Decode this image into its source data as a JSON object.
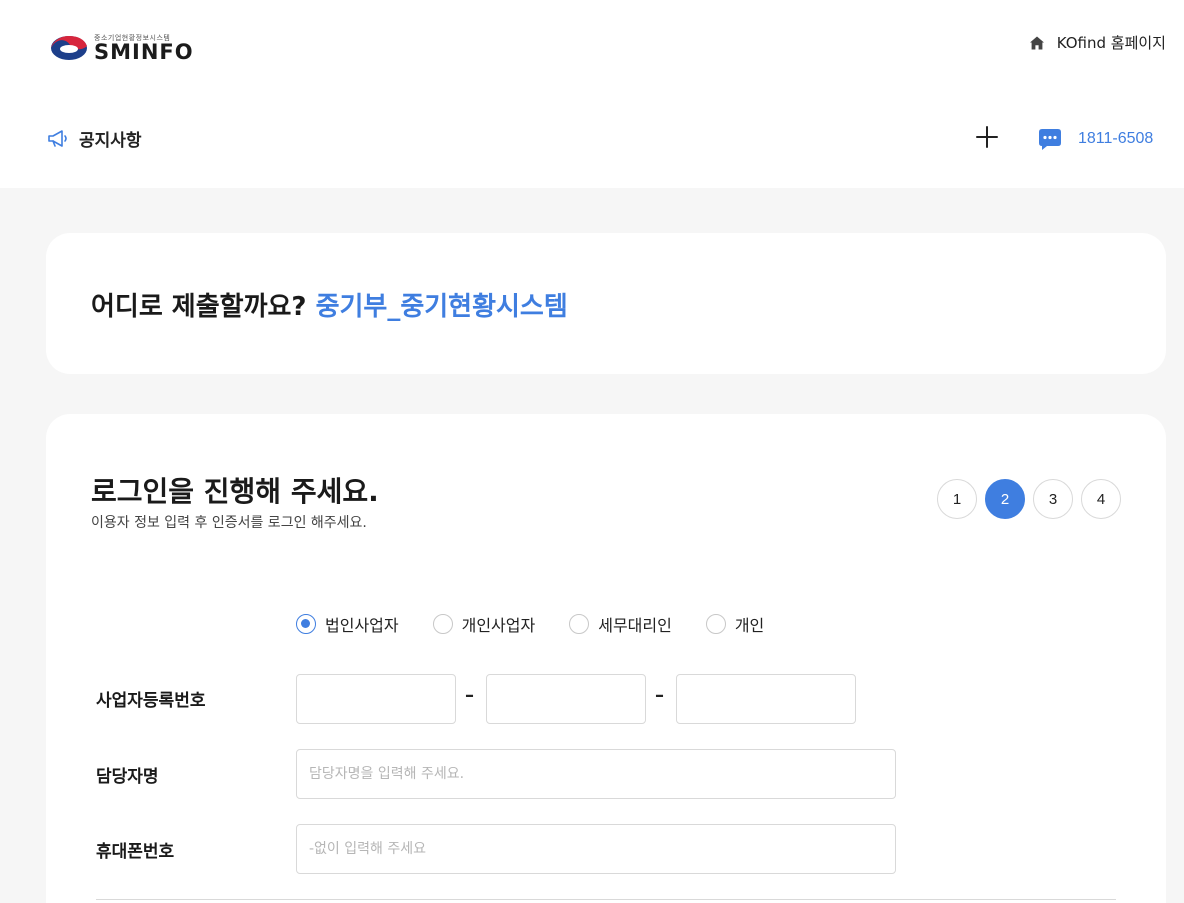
{
  "header": {
    "logo": {
      "subtitle": "중소기업현황정보시스템",
      "name": "SMINFO"
    },
    "home_link": "KOfind 홈페이지",
    "notice_label": "공지사항",
    "phone": "1811-6508"
  },
  "destination": {
    "question": "어디로 제출할까요?",
    "target": "중기부_중기현황시스템"
  },
  "login": {
    "title": "로그인을 진행해 주세요.",
    "subtitle": "이용자 정보 입력 후 인증서를 로그인 해주세요.",
    "steps": [
      "1",
      "2",
      "3",
      "4"
    ],
    "active_step": 2,
    "user_types": [
      {
        "label": "법인사업자",
        "checked": true
      },
      {
        "label": "개인사업자",
        "checked": false
      },
      {
        "label": "세무대리인",
        "checked": false
      },
      {
        "label": "개인",
        "checked": false
      }
    ],
    "fields": {
      "biz_number": {
        "label": "사업자등록번호",
        "separator": "–"
      },
      "manager_name": {
        "label": "담당자명",
        "placeholder": "담당자명을 입력해 주세요."
      },
      "phone": {
        "label": "휴대폰번호",
        "placeholder": "-없이 입력해 주세요"
      }
    }
  },
  "colors": {
    "accent": "#3f7ee0",
    "background": "#f6f6f6",
    "card": "#ffffff"
  }
}
